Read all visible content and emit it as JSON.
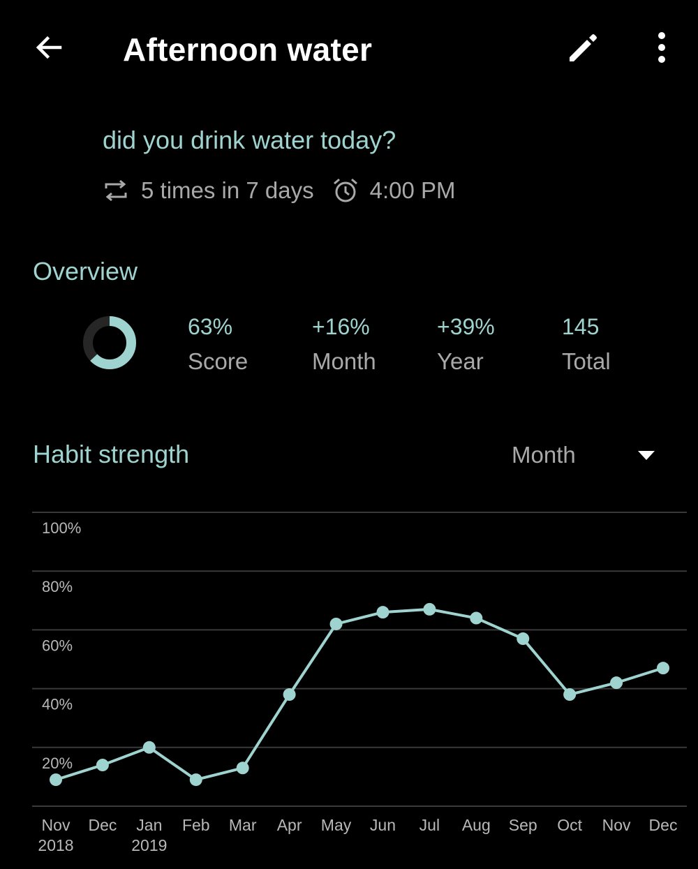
{
  "toolbar": {
    "title": "Afternoon water",
    "back_icon": "arrow-left-icon",
    "edit_icon": "pencil-icon",
    "more_icon": "more-vertical-icon"
  },
  "habit": {
    "question": "did you drink water today?",
    "frequency": "5 times in 7 days",
    "frequency_icon": "repeat-icon",
    "reminder": "4:00 PM",
    "reminder_icon": "alarm-clock-icon"
  },
  "overview": {
    "title": "Overview",
    "score_ring_fraction": 0.63,
    "stats": [
      {
        "value": "63%",
        "label": "Score"
      },
      {
        "value": "+16%",
        "label": "Month"
      },
      {
        "value": "+39%",
        "label": "Year"
      },
      {
        "value": "145",
        "label": "Total"
      }
    ]
  },
  "strength": {
    "title": "Habit strength",
    "range": "Month",
    "dropdown_icon": "triangle-down-icon"
  },
  "colors": {
    "accent": "#9ed3cf",
    "background": "#000000",
    "secondary_text": "#a9a9a9",
    "grid": "#3a3a3a"
  },
  "chart_data": {
    "type": "line",
    "x": [
      "Nov 2018",
      "Dec 2018",
      "Jan 2019",
      "Feb 2019",
      "Mar 2019",
      "Apr 2019",
      "May 2019",
      "Jun 2019",
      "Jul 2019",
      "Aug 2019",
      "Sep 2019",
      "Oct 2019",
      "Nov 2019",
      "Dec 2019"
    ],
    "x_tick_labels": [
      {
        "month": "Nov",
        "year": "2018"
      },
      {
        "month": "Dec",
        "year": ""
      },
      {
        "month": "Jan",
        "year": "2019"
      },
      {
        "month": "Feb",
        "year": ""
      },
      {
        "month": "Mar",
        "year": ""
      },
      {
        "month": "Apr",
        "year": ""
      },
      {
        "month": "May",
        "year": ""
      },
      {
        "month": "Jun",
        "year": ""
      },
      {
        "month": "Jul",
        "year": ""
      },
      {
        "month": "Aug",
        "year": ""
      },
      {
        "month": "Sep",
        "year": ""
      },
      {
        "month": "Oct",
        "year": ""
      },
      {
        "month": "Nov",
        "year": ""
      },
      {
        "month": "Dec",
        "year": ""
      }
    ],
    "series": [
      {
        "values": [
          9,
          14,
          20,
          9,
          13,
          38,
          62,
          66,
          67,
          64,
          57,
          38,
          42,
          47
        ]
      }
    ],
    "y_ticks": [
      "100%",
      "80%",
      "60%",
      "40%",
      "20%"
    ],
    "y_tick_values": [
      100,
      80,
      60,
      40,
      20
    ],
    "ylim": [
      0,
      100
    ],
    "grid": true,
    "color": "#9ed3cf"
  }
}
